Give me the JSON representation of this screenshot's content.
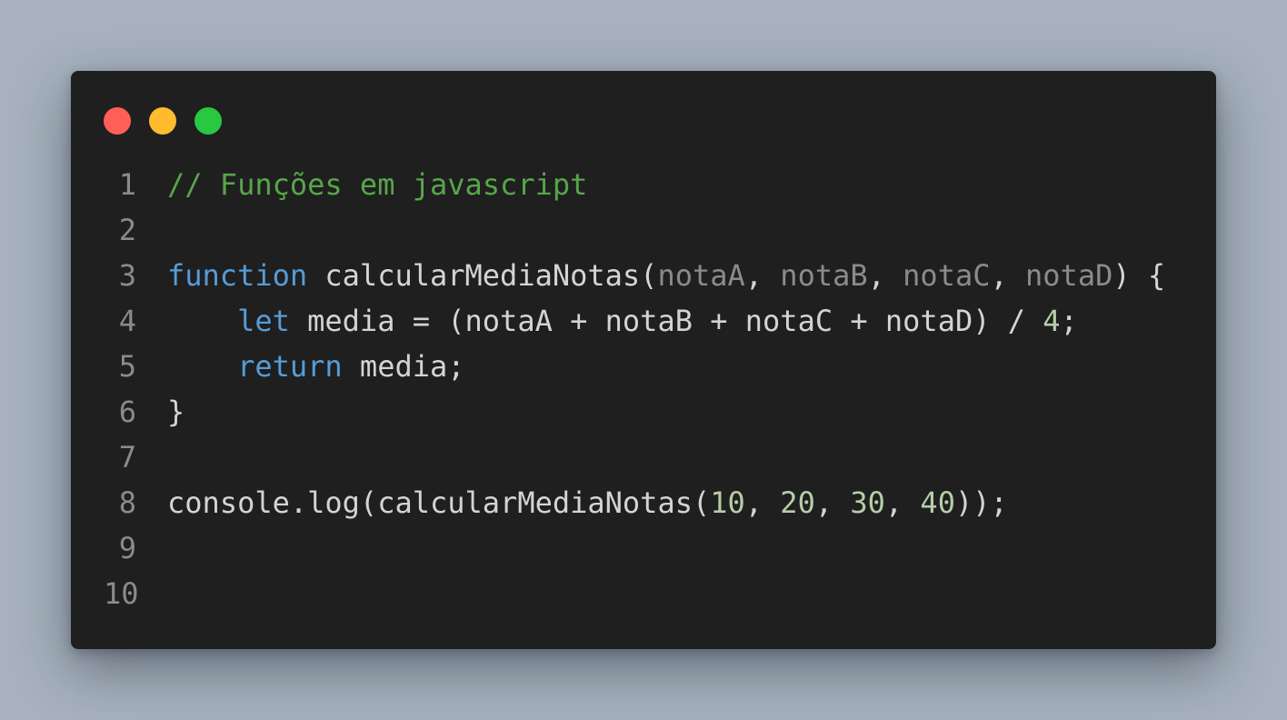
{
  "colors": {
    "background": "#a7b2be",
    "window": "#1f1f1f",
    "close": "#ff5f57",
    "minimize": "#febc2e",
    "maximize": "#28c840",
    "comment": "#57a64a",
    "keyword": "#569cd6",
    "param": "#8b8b8b",
    "number": "#b5cea8",
    "text": "#d4d4d4"
  },
  "code": {
    "lines": [
      {
        "number": "1",
        "tokens": [
          {
            "type": "comment",
            "text": "// Funções em javascript"
          }
        ]
      },
      {
        "number": "2",
        "tokens": []
      },
      {
        "number": "3",
        "tokens": [
          {
            "type": "keyword",
            "text": "function"
          },
          {
            "type": "plain",
            "text": " calcularMediaNotas("
          },
          {
            "type": "param",
            "text": "notaA"
          },
          {
            "type": "plain",
            "text": ", "
          },
          {
            "type": "param",
            "text": "notaB"
          },
          {
            "type": "plain",
            "text": ", "
          },
          {
            "type": "param",
            "text": "notaC"
          },
          {
            "type": "plain",
            "text": ", "
          },
          {
            "type": "param",
            "text": "notaD"
          },
          {
            "type": "plain",
            "text": ") {"
          }
        ]
      },
      {
        "number": "4",
        "tokens": [
          {
            "type": "plain",
            "text": "    "
          },
          {
            "type": "keyword",
            "text": "let"
          },
          {
            "type": "plain",
            "text": " media = (notaA + notaB + notaC + notaD) / "
          },
          {
            "type": "number",
            "text": "4"
          },
          {
            "type": "plain",
            "text": ";"
          }
        ]
      },
      {
        "number": "5",
        "tokens": [
          {
            "type": "plain",
            "text": "    "
          },
          {
            "type": "keyword",
            "text": "return"
          },
          {
            "type": "plain",
            "text": " media;"
          }
        ]
      },
      {
        "number": "6",
        "tokens": [
          {
            "type": "plain",
            "text": "}"
          }
        ]
      },
      {
        "number": "7",
        "tokens": []
      },
      {
        "number": "8",
        "tokens": [
          {
            "type": "plain",
            "text": "console.log(calcularMediaNotas("
          },
          {
            "type": "number",
            "text": "10"
          },
          {
            "type": "plain",
            "text": ", "
          },
          {
            "type": "number",
            "text": "20"
          },
          {
            "type": "plain",
            "text": ", "
          },
          {
            "type": "number",
            "text": "30"
          },
          {
            "type": "plain",
            "text": ", "
          },
          {
            "type": "number",
            "text": "40"
          },
          {
            "type": "plain",
            "text": "));"
          }
        ]
      },
      {
        "number": "9",
        "tokens": []
      },
      {
        "number": "10",
        "tokens": []
      }
    ]
  }
}
